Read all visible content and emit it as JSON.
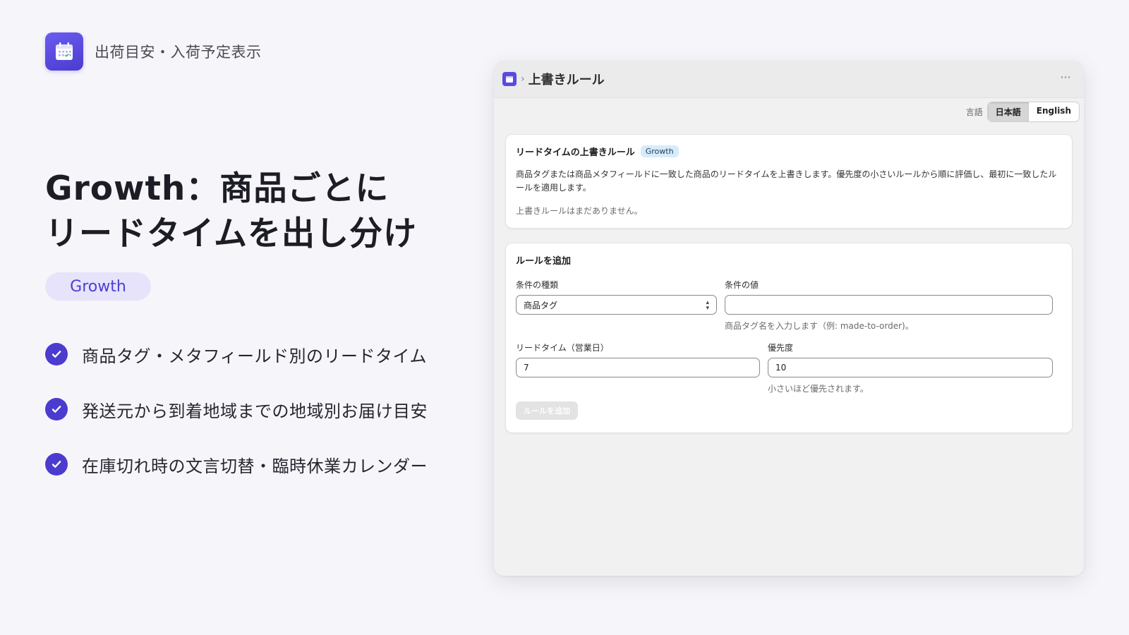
{
  "brand": {
    "name": "出荷目安・入荷予定表示"
  },
  "headline": {
    "line1": "Growth：商品ごとに",
    "line2": "リードタイムを出し分け"
  },
  "plan_pill": "Growth",
  "features": [
    "商品タグ・メタフィールド別のリードタイム",
    "発送元から到着地域までの地域別お届け目安",
    "在庫切れ時の文言切替・臨時休業カレンダー"
  ],
  "window": {
    "title": "上書きルール",
    "breadcrumb_sep": "›",
    "more_label": "···",
    "language": {
      "label": "言語",
      "options": [
        "日本語",
        "English"
      ],
      "selected": "日本語"
    },
    "rules_card": {
      "title": "リードタイムの上書きルール",
      "badge": "Growth",
      "description": "商品タグまたは商品メタフィールドに一致した商品のリードタイムを上書きします。優先度の小さいルールから順に評価し、最初に一致したルールを適用します。",
      "empty_text": "上書きルールはまだありません。"
    },
    "add_card": {
      "title": "ルールを追加",
      "condition_type": {
        "label": "条件の種類",
        "value": "商品タグ"
      },
      "condition_value": {
        "label": "条件の値",
        "value": "",
        "help": "商品タグ名を入力します（例: made-to-order)。"
      },
      "lead_time": {
        "label": "リードタイム（営業日）",
        "value": "7"
      },
      "priority": {
        "label": "優先度",
        "value": "10",
        "help": "小さいほど優先されます。"
      },
      "submit_label": "ルールを追加"
    }
  },
  "colors": {
    "accent": "#4b3ccf",
    "pill_bg": "#e6e3fb",
    "badge_bg": "#d7ecfa"
  }
}
